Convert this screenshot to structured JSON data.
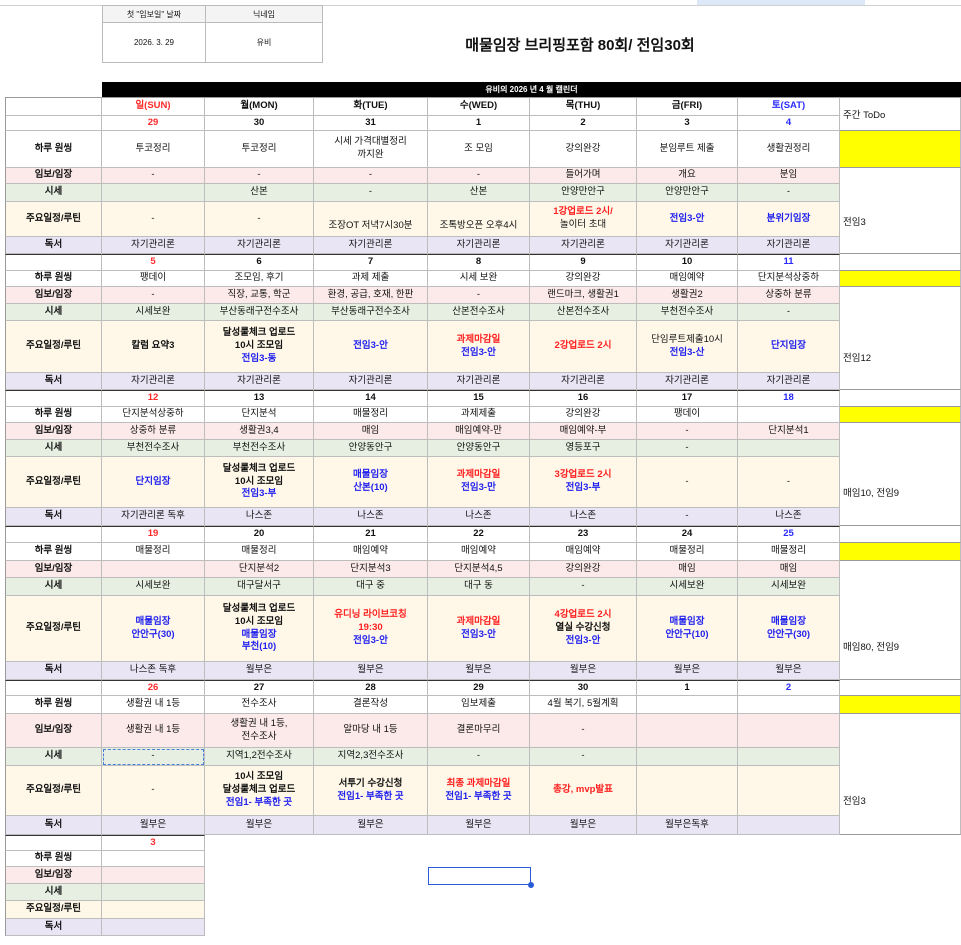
{
  "info": {
    "first_date_label": "첫 \"임보일\" 날짜",
    "nickname_label": "닉네임",
    "first_date": "2026. 3. 29",
    "nickname": "유비"
  },
  "title": "매물임장 브리핑포함 80회/ 전임30회",
  "calendar_title": "유비의 2026 년 4 월 캘린더",
  "days": [
    {
      "label": "일(SUN)",
      "color": "#ff2a2a"
    },
    {
      "label": "월(MON)",
      "color": "#111111"
    },
    {
      "label": "화(TUE)",
      "color": "#111111"
    },
    {
      "label": "수(WED)",
      "color": "#111111"
    },
    {
      "label": "목(THU)",
      "color": "#111111"
    },
    {
      "label": "금(FRI)",
      "color": "#111111"
    },
    {
      "label": "토(SAT)",
      "color": "#2a2aff"
    }
  ],
  "todo_header": "주간 ToDo",
  "row_labels": [
    "하루 원씽",
    "임보/임장",
    "시세",
    "주요일정/루틴",
    "독서"
  ],
  "colors": {
    "red": "#ff2020",
    "blue": "#2222ee",
    "black": "#111111",
    "yellow": "#ffff00"
  },
  "weeks": [
    {
      "dates": [
        "29",
        "30",
        "31",
        "1",
        "2",
        "3",
        "4"
      ],
      "daily": [
        "투코정리",
        "투코정리",
        "시세 가격대별정리\n까지완",
        "조 모임",
        "강의완강",
        "분임루트 제출",
        "생활권정리"
      ],
      "report": [
        "-",
        "-",
        "-",
        "-",
        "들어가며",
        "개요",
        "분임"
      ],
      "price": [
        "",
        "산본",
        "-",
        "산본",
        "안양만안구",
        "안양만안구",
        "-"
      ],
      "sched": [
        [
          {
            "text": "-",
            "color": "#111111"
          }
        ],
        [
          {
            "text": "-",
            "color": "#111111"
          }
        ],
        [
          {
            "text": "조장OT 저녁7시30분",
            "color": "#111111"
          }
        ],
        [
          {
            "text": "조톡방오픈 오후4시",
            "color": "#111111"
          }
        ],
        [
          {
            "text": "1강업로드 2시/",
            "color": "#ff2020",
            "bold": true
          },
          {
            "text": "놀이터 초대",
            "color": "#111111"
          }
        ],
        [
          {
            "text": "전임3-안",
            "color": "#2222ee",
            "bold": true
          }
        ],
        [
          {
            "text": "분위기임장",
            "color": "#2222ee",
            "bold": true
          }
        ]
      ],
      "read": [
        "자기관리론",
        "자기관리론",
        "자기관리론",
        "자기관리론",
        "자기관리론",
        "자기관리론",
        "자기관리론"
      ],
      "todo": "전임3"
    },
    {
      "dates": [
        "5",
        "6",
        "7",
        "8",
        "9",
        "10",
        "11"
      ],
      "daily": [
        "팽데이",
        "조모임, 후기",
        "과제 제출",
        "시세 보완",
        "강의완강",
        "매임예약",
        "단지분석상중하"
      ],
      "report": [
        "-",
        "직장, 교통, 학군",
        "환경, 공급, 호재, 한판",
        "-",
        "랜드마크, 생활권1",
        "생활권2",
        "상중하 분류"
      ],
      "price": [
        "시세보완",
        "부산동래구전수조사",
        "부산동래구전수조사",
        "산본전수조사",
        "산본전수조사",
        "부천전수조사",
        "-"
      ],
      "sched": [
        [
          {
            "text": "칼럼 요약3",
            "color": "#111111",
            "bold": true
          }
        ],
        [
          {
            "text": "달성룰체크 업로드",
            "color": "#111111",
            "bold": true
          },
          {
            "text": "10시 조모임",
            "color": "#111111",
            "bold": true
          },
          {
            "text": "전임3-동",
            "color": "#2222ee",
            "bold": true
          }
        ],
        [
          {
            "text": "전임3-안",
            "color": "#2222ee",
            "bold": true
          }
        ],
        [
          {
            "text": "과제마감일",
            "color": "#ff2020",
            "bold": true
          },
          {
            "text": "전임3-안",
            "color": "#2222ee",
            "bold": true
          }
        ],
        [
          {
            "text": "2강업로드 2시",
            "color": "#ff2020",
            "bold": true
          }
        ],
        [
          {
            "text": "단임루트제출10시",
            "color": "#111111"
          },
          {
            "text": "전임3-산",
            "color": "#2222ee",
            "bold": true
          }
        ],
        [
          {
            "text": "단지임장",
            "color": "#2222ee",
            "bold": true
          }
        ]
      ],
      "read": [
        "자기관리론",
        "자기관리론",
        "자기관리론",
        "자기관리론",
        "자기관리론",
        "자기관리론",
        "자기관리론"
      ],
      "todo": "전임12"
    },
    {
      "dates": [
        "12",
        "13",
        "14",
        "15",
        "16",
        "17",
        "18"
      ],
      "daily": [
        "단지분석상중하",
        "단지분석",
        "매물정리",
        "과제제출",
        "강의완강",
        "팽데이",
        ""
      ],
      "report": [
        "상중하 분류",
        "생활권3,4",
        "매임",
        "매임예약-만",
        "매임예약-부",
        "-",
        "단지분석1"
      ],
      "price": [
        "부천전수조사",
        "부천전수조사",
        "안양동안구",
        "안양동안구",
        "영등포구",
        "-",
        ""
      ],
      "sched": [
        [
          {
            "text": "단지임장",
            "color": "#2222ee",
            "bold": true
          }
        ],
        [
          {
            "text": "달성룰체크 업로드",
            "color": "#111111",
            "bold": true
          },
          {
            "text": "10시 조모임",
            "color": "#111111",
            "bold": true
          },
          {
            "text": "전임3-부",
            "color": "#2222ee",
            "bold": true
          }
        ],
        [
          {
            "text": "매물임장",
            "color": "#2222ee",
            "bold": true
          },
          {
            "text": "산본(10)",
            "color": "#2222ee",
            "bold": true
          }
        ],
        [
          {
            "text": "과제마감일",
            "color": "#ff2020",
            "bold": true
          },
          {
            "text": "전임3-만",
            "color": "#2222ee",
            "bold": true
          }
        ],
        [
          {
            "text": "3강업로드 2시",
            "color": "#ff2020",
            "bold": true
          },
          {
            "text": "전임3-부",
            "color": "#2222ee",
            "bold": true
          }
        ],
        [
          {
            "text": "-",
            "color": "#111111"
          }
        ],
        [
          {
            "text": "-",
            "color": "#111111"
          }
        ]
      ],
      "read": [
        "자기관리론 독후",
        "나스존",
        "나스존",
        "나스존",
        "나스존",
        "-",
        "나스존"
      ],
      "todo": "매임10, 전임9"
    },
    {
      "dates": [
        "19",
        "20",
        "21",
        "22",
        "23",
        "24",
        "25"
      ],
      "daily": [
        "매물정리",
        "매물정리",
        "매임예약",
        "매임예약",
        "매임예약",
        "매물정리",
        "매물정리"
      ],
      "report": [
        "",
        "단지분석2",
        "단지분석3",
        "단지분석4,5",
        "강의완강",
        "매임",
        "매임"
      ],
      "price": [
        "시세보완",
        "대구달서구",
        "대구 중",
        "대구 동",
        "-",
        "시세보완",
        "시세보완"
      ],
      "sched": [
        [
          {
            "text": "매물임장",
            "color": "#2222ee",
            "bold": true
          },
          {
            "text": "안안구(30)",
            "color": "#2222ee",
            "bold": true
          }
        ],
        [
          {
            "text": "달성룰체크 업로드",
            "color": "#111111",
            "bold": true
          },
          {
            "text": "10시 조모임",
            "color": "#111111",
            "bold": true
          },
          {
            "text": "매물임장",
            "color": "#2222ee",
            "bold": true
          },
          {
            "text": "부천(10)",
            "color": "#2222ee",
            "bold": true
          }
        ],
        [
          {
            "text": "유디닝 라이브코칭",
            "color": "#ff2020",
            "bold": true
          },
          {
            "text": "19:30",
            "color": "#ff2020",
            "bold": true
          },
          {
            "text": "전임3-안",
            "color": "#2222ee",
            "bold": true
          }
        ],
        [
          {
            "text": "과제마감일",
            "color": "#ff2020",
            "bold": true
          },
          {
            "text": "전임3-안",
            "color": "#2222ee",
            "bold": true
          }
        ],
        [
          {
            "text": "4강업로드 2시",
            "color": "#ff2020",
            "bold": true
          },
          {
            "text": "열실 수강신청",
            "color": "#111111",
            "bold": true
          },
          {
            "text": "전임3-안",
            "color": "#2222ee",
            "bold": true
          }
        ],
        [
          {
            "text": "매물임장",
            "color": "#2222ee",
            "bold": true
          },
          {
            "text": "안안구(10)",
            "color": "#2222ee",
            "bold": true
          }
        ],
        [
          {
            "text": "매물임장",
            "color": "#2222ee",
            "bold": true
          },
          {
            "text": "안안구(30)",
            "color": "#2222ee",
            "bold": true
          }
        ]
      ],
      "read": [
        "나스존 독후",
        "월부은",
        "월부은",
        "월부은",
        "월부은",
        "월부은",
        "월부은"
      ],
      "todo": "매임80, 전임9"
    },
    {
      "dates": [
        "26",
        "27",
        "28",
        "29",
        "30",
        "1",
        "2"
      ],
      "daily": [
        "생활권 내 1등",
        "전수조사",
        "결론작성",
        "임보제출",
        "4월 복기, 5월계획",
        "",
        ""
      ],
      "report": [
        "생활권 내 1등",
        "생활권 내 1등,\n전수조사",
        "알마당 내 1등",
        "결론마무리",
        "-",
        "",
        ""
      ],
      "price": [
        "-",
        "지역1,2전수조사",
        "지역2,3전수조사",
        "-",
        "-",
        "",
        ""
      ],
      "sched": [
        [
          {
            "text": "-",
            "color": "#111111"
          }
        ],
        [
          {
            "text": "10시 조모임",
            "color": "#111111",
            "bold": true
          },
          {
            "text": "달성룰체크 업로드",
            "color": "#111111",
            "bold": true
          },
          {
            "text": "전임1- 부족한 곳",
            "color": "#2222ee",
            "bold": true
          }
        ],
        [
          {
            "text": "서투기 수강신청",
            "color": "#111111",
            "bold": true
          },
          {
            "text": "전임1- 부족한 곳",
            "color": "#2222ee",
            "bold": true
          }
        ],
        [
          {
            "text": "최종 과제마감일",
            "color": "#ff2020",
            "bold": true
          },
          {
            "text": "전임1- 부족한 곳",
            "color": "#2222ee",
            "bold": true
          }
        ],
        [
          {
            "text": "총강, mvp발표",
            "color": "#ff2020",
            "bold": true
          }
        ],
        [],
        []
      ],
      "read": [
        "월부은",
        "월부은",
        "월부은",
        "월부은",
        "월부은",
        "월부은독후",
        ""
      ],
      "todo": "전임3"
    },
    {
      "dates": [
        "3"
      ],
      "daily": [
        ""
      ],
      "report": [
        ""
      ],
      "price": [
        ""
      ],
      "sched": [
        []
      ],
      "read": [
        ""
      ],
      "todo": ""
    }
  ]
}
